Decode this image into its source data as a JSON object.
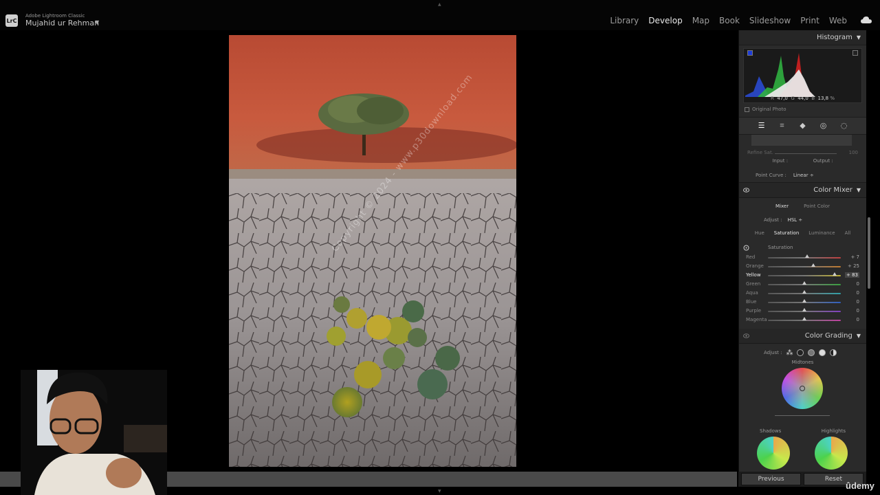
{
  "app": {
    "product": "Adobe Lightroom Classic",
    "logo": "LrC",
    "user": "Mujahid ur Rehman"
  },
  "modules": [
    {
      "label": "Library",
      "active": false
    },
    {
      "label": "Develop",
      "active": true
    },
    {
      "label": "Map",
      "active": false
    },
    {
      "label": "Book",
      "active": false
    },
    {
      "label": "Slideshow",
      "active": false
    },
    {
      "label": "Print",
      "active": false
    },
    {
      "label": "Web",
      "active": false
    }
  ],
  "watermark": "Copyright © 2024 - www.p30download.com",
  "histogram": {
    "title": "Histogram",
    "r_label": "R",
    "r": "47,0",
    "g_label": "G",
    "g": "44,0",
    "b_label": "B",
    "b": "13,8",
    "pct": "%",
    "original_photo": "Original Photo"
  },
  "tone_curve": {
    "refine_sat": "Refine Sat.",
    "refine_val": "100",
    "input": "Input :",
    "output": "Output :",
    "point_curve_label": "Point Curve :",
    "point_curve_value": "Linear ÷"
  },
  "color_mixer": {
    "title": "Color Mixer",
    "tabs": [
      "Mixer",
      "Point Color"
    ],
    "adjust_label": "Adjust :",
    "adjust_value": "HSL ÷",
    "hsl_tabs": [
      "Hue",
      "Saturation",
      "Luminance",
      "All"
    ],
    "section_label": "Saturation",
    "sliders": [
      {
        "label": "Red",
        "value": "+ 7",
        "frac": 0.535,
        "color": "#c04040"
      },
      {
        "label": "Orange",
        "value": "+ 25",
        "frac": 0.625,
        "color": "#c07a30"
      },
      {
        "label": "Yellow",
        "value": "+ 83",
        "frac": 0.915,
        "color": "#c0b030"
      },
      {
        "label": "Green",
        "value": "0",
        "frac": 0.5,
        "color": "#3aa040"
      },
      {
        "label": "Aqua",
        "value": "0",
        "frac": 0.5,
        "color": "#30a0a8"
      },
      {
        "label": "Blue",
        "value": "0",
        "frac": 0.5,
        "color": "#3060c0"
      },
      {
        "label": "Purple",
        "value": "0",
        "frac": 0.5,
        "color": "#8040c0"
      },
      {
        "label": "Magenta",
        "value": "0",
        "frac": 0.5,
        "color": "#c040a0"
      }
    ]
  },
  "color_grading": {
    "title": "Color Grading",
    "adjust_label": "Adjust :",
    "midtones": "Midtones",
    "shadows": "Shadows",
    "highlights": "Highlights"
  },
  "buttons": {
    "previous": "Previous",
    "reset": "Reset"
  },
  "brand": "ûdemy"
}
